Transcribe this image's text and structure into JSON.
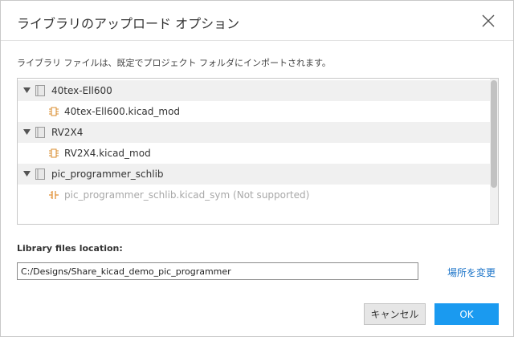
{
  "dialog": {
    "title": "ライブラリのアップロード オプション",
    "close_icon": "close-icon"
  },
  "description": "ライブラリ ファイルは、既定でプロジェクト フォルダにインポートされます。",
  "tree": {
    "groups": [
      {
        "label": "40tex-Ell600",
        "expanded": true,
        "file": {
          "label": "40tex-Ell600.kicad_mod",
          "icon": "footprint-icon",
          "supported": true
        }
      },
      {
        "label": "RV2X4",
        "expanded": true,
        "file": {
          "label": "RV2X4.kicad_mod",
          "icon": "footprint-icon",
          "supported": true
        }
      },
      {
        "label": "pic_programmer_schlib",
        "expanded": true,
        "file": {
          "label": "pic_programmer_schlib.kicad_sym (Not supported)",
          "icon": "symbol-icon",
          "supported": false
        }
      }
    ]
  },
  "location": {
    "label": "Library files location:",
    "value": "C:/Designs/Share_kicad_demo_pic_programmer",
    "change_label": "場所を変更"
  },
  "buttons": {
    "cancel": "キャンセル",
    "ok": "OK"
  },
  "colors": {
    "accent": "#1a9af0",
    "link": "#1a73c8",
    "disabled_text": "#a8a8a8"
  }
}
